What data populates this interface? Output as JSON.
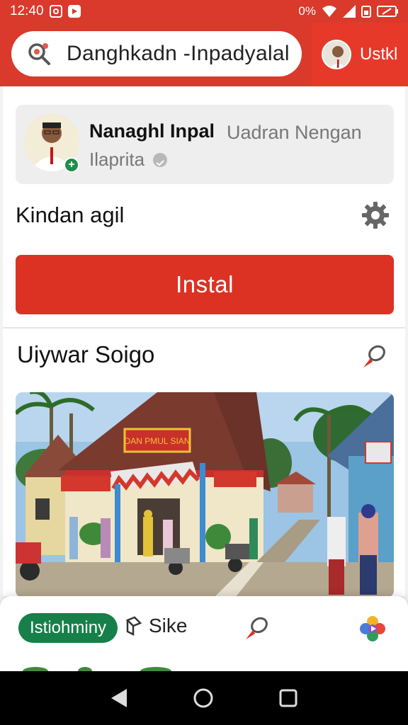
{
  "status_bar": {
    "time": "12:40",
    "battery_text": "0%"
  },
  "header": {
    "search_text": "Danghkadn -Inpadyalal",
    "user_name": "Ustkl"
  },
  "profile": {
    "name": "Nanaghl Inpal",
    "subtitle": "Uadran Nengan",
    "subtitle2": "Ilaprita"
  },
  "settings": {
    "label": "Kindan agil"
  },
  "install_button": {
    "label": "Instal"
  },
  "section": {
    "title": "Uiywar Soigo"
  },
  "photo": {
    "sign_text": "DAN PMUL SIAN"
  },
  "action_bar": {
    "chip_label": "Istiohminy",
    "item_label": "Sike"
  },
  "colors": {
    "brand_red": "#d93a2b",
    "button_red": "#dc3224",
    "chip_green": "#17804a"
  },
  "icons": {
    "search": "search-icon",
    "gear": "gear-icon",
    "pin": "pin-icon",
    "share": "share-icon",
    "app": "app-logo-icon"
  }
}
